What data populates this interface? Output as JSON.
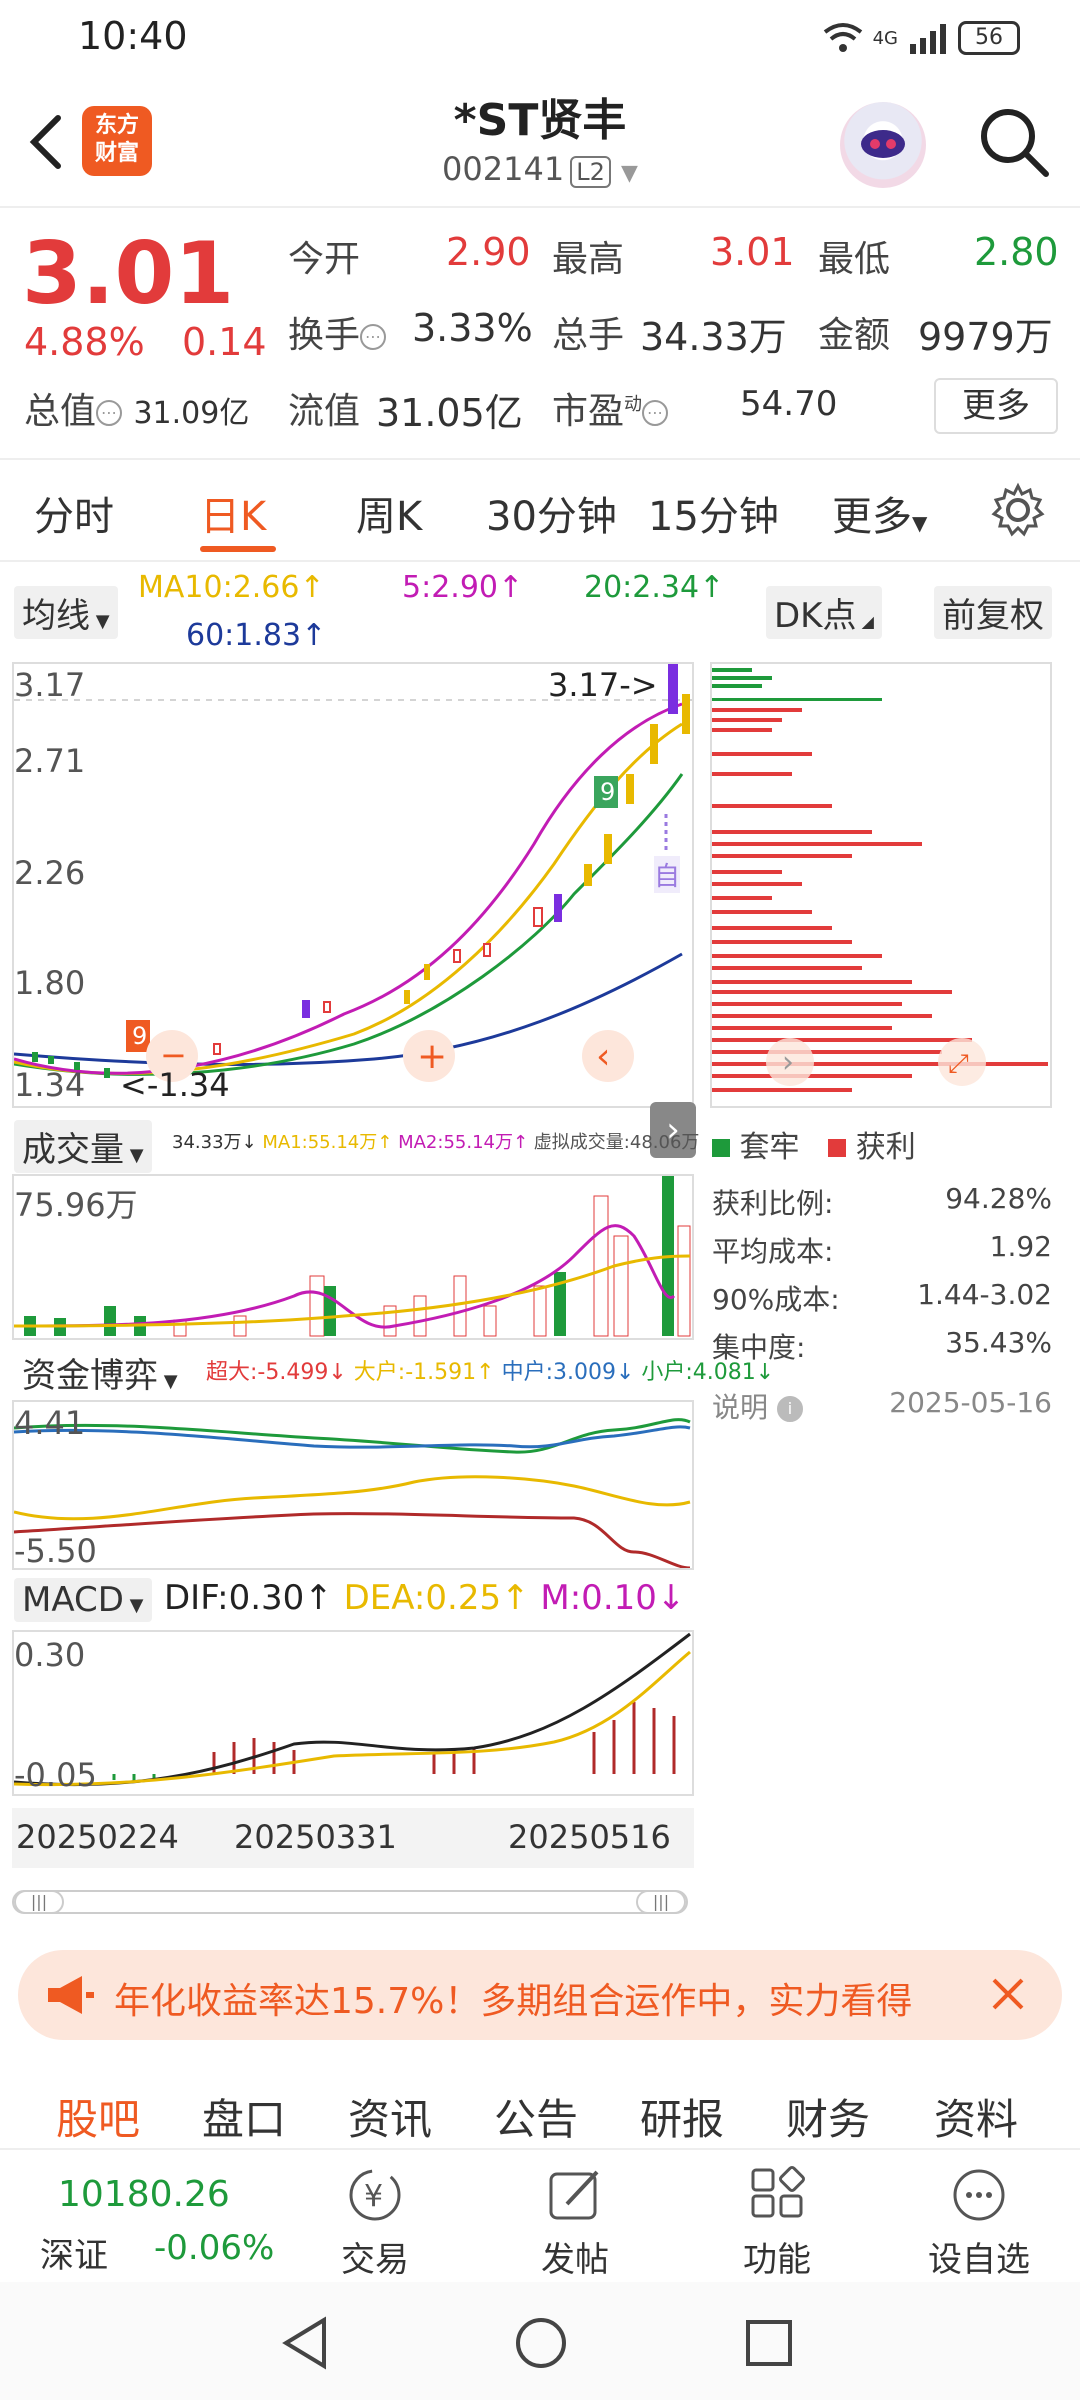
{
  "status": {
    "time": "10:40",
    "signal": "4G",
    "battery": "56"
  },
  "header": {
    "app_logo": "东方\n财富",
    "title": "*ST贤丰",
    "code": "002141",
    "level_badge": "L2"
  },
  "quote": {
    "price": "3.01",
    "change_pct": "4.88%",
    "change": "0.14",
    "open_label": "今开",
    "open": "2.90",
    "high_label": "最高",
    "high": "3.01",
    "low_label": "最低",
    "low": "2.80",
    "turnover_label": "换手",
    "turnover": "3.33%",
    "volume_label": "总手",
    "volume": "34.33万",
    "amount_label": "金额",
    "amount": "9979万",
    "total_mcap_label": "总值",
    "total_mcap": "31.09亿",
    "float_mcap_label": "流值",
    "float_mcap": "31.05亿",
    "pe_label": "市盈",
    "pe_sup": "动",
    "pe": "54.70",
    "more": "更多"
  },
  "tabs": [
    "分时",
    "日K",
    "周K",
    "30分钟",
    "15分钟",
    "更多"
  ],
  "active_tab": "日K",
  "ma_row": {
    "selector": "均线",
    "ma10": "MA10:2.66↑",
    "ma5": "5:2.90↑",
    "ma20": "20:2.34↑",
    "ma60": "60:1.83↑",
    "dk_button": "DK点",
    "adjust_button": "前复权"
  },
  "kline": {
    "y_labels": [
      "3.17",
      "2.71",
      "2.26",
      "1.80",
      "1.34"
    ],
    "high_marker": "3.17->",
    "low_marker": "<-1.34",
    "auto_label": "自"
  },
  "volume_panel": {
    "selector": "成交量",
    "legend": "34.33万↓",
    "ma1": "MA1:55.14万↑",
    "ma2": "MA2:55.14万↑",
    "virtual": "虚拟成交量:48.06万",
    "y_label": "75.96万"
  },
  "capital_panel": {
    "selector": "资金博弈",
    "super": "超大:-5.499↓",
    "large": "大户:-1.591↑",
    "mid": "中户:3.009↓",
    "small": "小户:4.081↓",
    "y_top": "4.41",
    "y_bottom": "-5.50"
  },
  "macd_panel": {
    "selector": "MACD",
    "dif": "DIF:0.30↑",
    "dea": "DEA:0.25↑",
    "m": "M:0.10↓",
    "y_top": "0.30",
    "y_bottom": "-0.05"
  },
  "x_dates": [
    "20250224",
    "20250331",
    "20250516"
  ],
  "chip": {
    "legend_trapped": "套牢",
    "legend_profit": "获利",
    "stats": [
      {
        "label": "获利比例:",
        "value": "94.28%"
      },
      {
        "label": "平均成本:",
        "value": "1.92"
      },
      {
        "label": "90%成本:",
        "value": "1.44-3.02"
      },
      {
        "label": "集中度:",
        "value": "35.43%"
      }
    ],
    "note": "说明",
    "date": "2025-05-16"
  },
  "promo": {
    "text": "年化收益率达15.7%！多期组合运作中，实力看得"
  },
  "community_tabs": [
    "股吧",
    "盘口",
    "资讯",
    "公告",
    "研报",
    "财务",
    "资料"
  ],
  "index": {
    "value": "10180.26",
    "name": "深证",
    "change": "-0.06%"
  },
  "toolbar": [
    "交易",
    "发帖",
    "功能",
    "设自选"
  ],
  "colors": {
    "accent": "#ef5a22",
    "up": "#e23b3b",
    "down": "#1e9a3b",
    "ma5": "#c21cb4",
    "ma10": "#e8b900",
    "ma20": "#1e9a3b",
    "ma60": "#1d3a9a"
  }
}
